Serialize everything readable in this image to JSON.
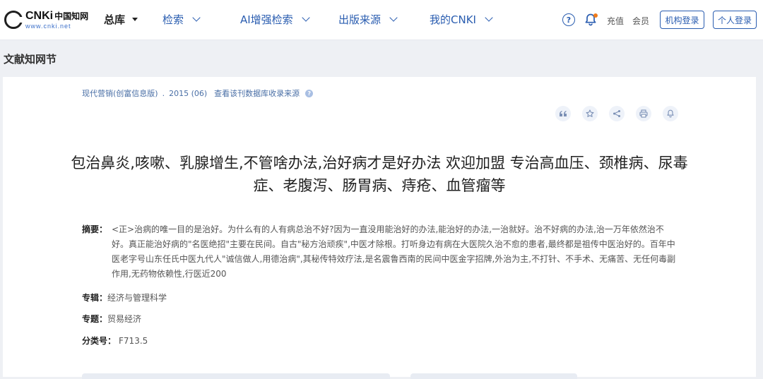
{
  "header": {
    "logo": {
      "brand": "CNKi",
      "brand_cn": "中国知网",
      "url": "www.cnki.net"
    },
    "nav": [
      {
        "label": "总库",
        "icon": "caret-down-icon"
      },
      {
        "label": "检索",
        "icon": "chevron-down-icon"
      },
      {
        "label": "AI增强检索",
        "icon": "chevron-down-icon"
      },
      {
        "label": "出版来源",
        "icon": "chevron-down-icon"
      },
      {
        "label": "我的CNKI",
        "icon": "chevron-down-icon"
      }
    ],
    "help_glyph": "?",
    "recharge": "充值",
    "member": "会员",
    "org_login": "机构登录",
    "personal_login": "个人登录"
  },
  "section_title": "文献知网节",
  "article": {
    "source_journal": "现代营销(创富信息版)",
    "source_issue": "2015 (06)",
    "source_link": "查看该刊数据库收录来源",
    "title": "包治鼻炎,咳嗽、乳腺增生,不管啥办法,治好病才是好办法 欢迎加盟 专治高血压、颈椎病、尿毒症、老腹泻、肠胃病、痔疮、血管瘤等",
    "abstract_label": "摘要：",
    "abstract": "<正>治病的唯一目的是治好。为什么有的人有病总治不好?因为一直没用能治好的办法,能治好的办法,一治就好。治不好病的办法,治一万年依然治不好。真正能治好病的\"名医绝招\"主要在民间。自古\"秘方治顽疾\",中医才除根。打听身边有病在大医院久治不愈的患者,最终都是祖传中医治好的。百年中医老字号山东任氏中医九代人\"诚信做人,用德治病\",其秘传特效疗法,是名震鲁西南的民间中医金字招牌,外治为主,不打针、不手术、无痛苦、无任何毒副作用,无药物依赖性,行医近200",
    "zhuanji_label": "专辑：",
    "zhuanji": "经济与管理科学",
    "zhuanti_label": "专题：",
    "zhuanti": "贸易经济",
    "class_label": "分类号：",
    "class_no": "F713.5"
  },
  "tools": [
    "quote-icon",
    "star-icon",
    "share-icon",
    "print-icon",
    "bell-icon"
  ],
  "colors": {
    "accent": "#2a5db0",
    "link": "#4a6fa6",
    "page_bg": "#eef0f4",
    "notify_dot": "#f07b1a"
  }
}
